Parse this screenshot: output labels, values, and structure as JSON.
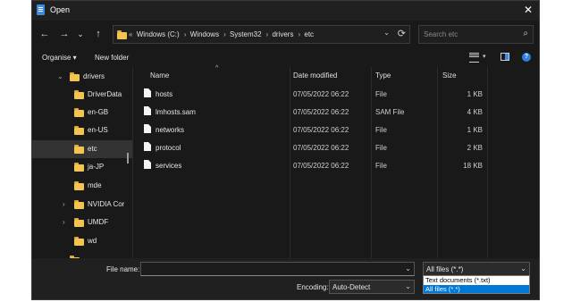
{
  "window": {
    "title": "Open",
    "close_label": "✕"
  },
  "nav": {
    "back": "←",
    "forward": "→",
    "up_history": "⌄",
    "up": "↑",
    "address": {
      "overflow": "«",
      "crumbs": [
        "Windows (C:)",
        "Windows",
        "System32",
        "drivers",
        "etc"
      ]
    },
    "address_dropdown": "⌄",
    "refresh": "⟳",
    "search_placeholder": "Search etc",
    "search_icon": "⌕"
  },
  "toolbar": {
    "organise": "Organise ▾",
    "new_folder": "New folder",
    "help": "?"
  },
  "sidebar": {
    "items": [
      {
        "label": "drivers",
        "chevron": "⌄"
      },
      {
        "label": "DriverData",
        "chevron": ""
      },
      {
        "label": "en-GB",
        "chevron": ""
      },
      {
        "label": "en-US",
        "chevron": ""
      },
      {
        "label": "etc",
        "chevron": ""
      },
      {
        "label": "ja-JP",
        "chevron": ""
      },
      {
        "label": "mde",
        "chevron": ""
      },
      {
        "label": "NVIDIA Cor",
        "chevron": "›"
      },
      {
        "label": "UMDF",
        "chevron": "›"
      },
      {
        "label": "wd",
        "chevron": ""
      }
    ]
  },
  "columns": {
    "name": "Name",
    "date": "Date modified",
    "type": "Type",
    "size": "Size",
    "sort_arrow": "^"
  },
  "files": [
    {
      "name": "hosts",
      "date": "07/05/2022 06:22",
      "type": "File",
      "size": "1 KB"
    },
    {
      "name": "lmhosts.sam",
      "date": "07/05/2022 06:22",
      "type": "SAM File",
      "size": "4 KB"
    },
    {
      "name": "networks",
      "date": "07/05/2022 06:22",
      "type": "File",
      "size": "1 KB"
    },
    {
      "name": "protocol",
      "date": "07/05/2022 06:22",
      "type": "File",
      "size": "2 KB"
    },
    {
      "name": "services",
      "date": "07/05/2022 06:22",
      "type": "File",
      "size": "18 KB"
    }
  ],
  "bottom": {
    "file_name_label": "File name:",
    "file_name_value": "",
    "file_name_drop": "⌄",
    "encoding_label": "Encoding:",
    "encoding_value": "Auto-Detect",
    "encoding_drop": "⌄",
    "filter_value": "All files  (*.*)",
    "filter_drop": "⌄",
    "filter_options": [
      "Text documents (*.txt)",
      "All files  (*.*)"
    ]
  },
  "colors": {
    "accent": "#0078d7",
    "folder": "#f4c44e",
    "background": "#191919"
  }
}
